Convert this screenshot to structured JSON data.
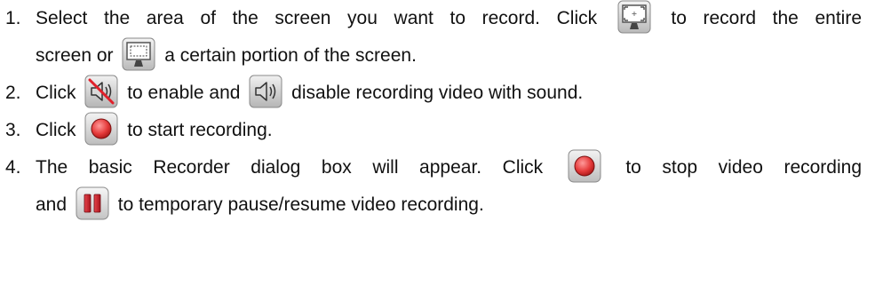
{
  "steps": [
    {
      "num": "1.",
      "t1": "Select the area of the screen you want to record. Click",
      "t2": "to record the entire",
      "t3": "screen or",
      "t4": "a certain portion of the screen.",
      "icon_a": "fullscreen-monitor-icon",
      "icon_b": "region-monitor-icon"
    },
    {
      "num": "2.",
      "t1": "Click",
      "t2": "to enable and",
      "t3": "disable recording video with sound.",
      "icon_a": "speaker-muted-icon",
      "icon_b": "speaker-on-icon"
    },
    {
      "num": "3.",
      "t1": "Click",
      "t2": "to start recording.",
      "icon_a": "record-icon"
    },
    {
      "num": "4.",
      "t1": "The basic Recorder dialog box will appear. Click",
      "t2": "to stop video recording",
      "t3": "and",
      "t4": "to temporary pause/resume video recording.",
      "icon_a": "stop-record-icon",
      "icon_b": "pause-icon"
    }
  ],
  "colors": {
    "text": "#111111",
    "record_red": "#e53b3b",
    "pause_red": "#c8202a",
    "mute_slash": "#e0202a"
  }
}
